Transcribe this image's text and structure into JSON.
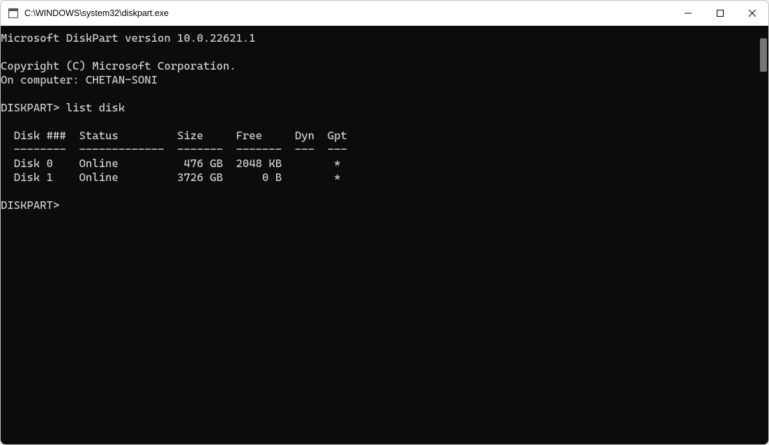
{
  "window": {
    "title": "C:\\WINDOWS\\system32\\diskpart.exe"
  },
  "terminal": {
    "header_version": "Microsoft DiskPart version 10.0.22621.1",
    "blank1": "",
    "copyright": "Copyright (C) Microsoft Corporation.",
    "on_computer": "On computer: CHETAN-SONI",
    "blank2": "",
    "prompt_command": "DISKPART> list disk",
    "blank3": "",
    "table_header": "  Disk ###  Status         Size     Free     Dyn  Gpt",
    "table_divider": "  --------  -------------  -------  -------  ---  ---",
    "row_disk0": "  Disk 0    Online          476 GB  2048 KB        *",
    "row_disk1": "  Disk 1    Online         3726 GB      0 B        *",
    "blank4": "",
    "prompt_empty": "DISKPART>"
  }
}
